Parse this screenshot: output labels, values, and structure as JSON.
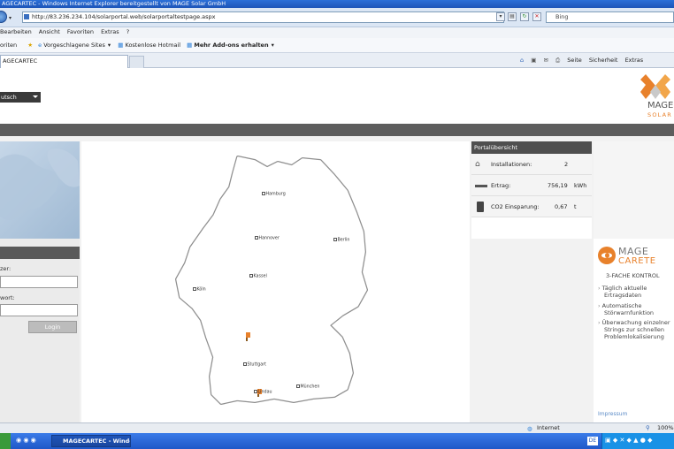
{
  "window": {
    "title": "AGECARTEC - Windows Internet Explorer bereitgestellt von MAGE Solar GmbH"
  },
  "addressbar": {
    "url": "http://83.236.234.104/solarportal.web/solarportaltestpage.aspx",
    "search_placeholder": "Bing"
  },
  "menubar": {
    "items": [
      "Bearbeiten",
      "Ansicht",
      "Favoriten",
      "Extras",
      "?"
    ]
  },
  "favbar": {
    "favorites": "oriten",
    "suggested": "Vorgeschlagene Sites",
    "hotmail": "Kostenlose Hotmail",
    "addons": "Mehr Add-ons erhalten"
  },
  "tab": {
    "label": "AGECARTEC"
  },
  "tools": {
    "page": "Seite",
    "safety": "Sicherheit",
    "extras": "Extras"
  },
  "header": {
    "language": "utsch"
  },
  "login": {
    "title": "",
    "user_label": "zer:",
    "password_label": "wort:",
    "button": "Login"
  },
  "map": {
    "cities": [
      {
        "name": "Hamburg"
      },
      {
        "name": "Hannover"
      },
      {
        "name": "Berlin"
      },
      {
        "name": "Kassel"
      },
      {
        "name": "Köln"
      },
      {
        "name": "Stuttgart"
      },
      {
        "name": "München"
      },
      {
        "name": "Lindau"
      }
    ]
  },
  "portal": {
    "title": "Portalübersicht",
    "installations_label": "Installationen:",
    "installations_value": "2",
    "yield_label": "Ertrag:",
    "yield_value": "756,19",
    "yield_unit": "kWh",
    "co2_label": "CO2 Einsparung:",
    "co2_value": "0,67",
    "co2_unit": "t"
  },
  "ad": {
    "brand_top": "MAGE",
    "brand_bottom": "CARETE",
    "tagline": "3-FACHE KONTROL",
    "bullets": [
      [
        "Täglich aktuelle",
        "Ertragsdaten"
      ],
      [
        "Automatische",
        "Störwarnfunktion"
      ],
      [
        "Überwachung einzelner",
        "Strings zur schnellen",
        "Problemlokalisierung"
      ]
    ],
    "impressum": "Impressum"
  },
  "status": {
    "zone": "Internet",
    "zoom": "100%"
  },
  "taskbar": {
    "app": "MAGECARTEC - Windo..."
  },
  "colors": {
    "accent_orange": "#e8812b",
    "header_grey": "#5d5d5d"
  }
}
